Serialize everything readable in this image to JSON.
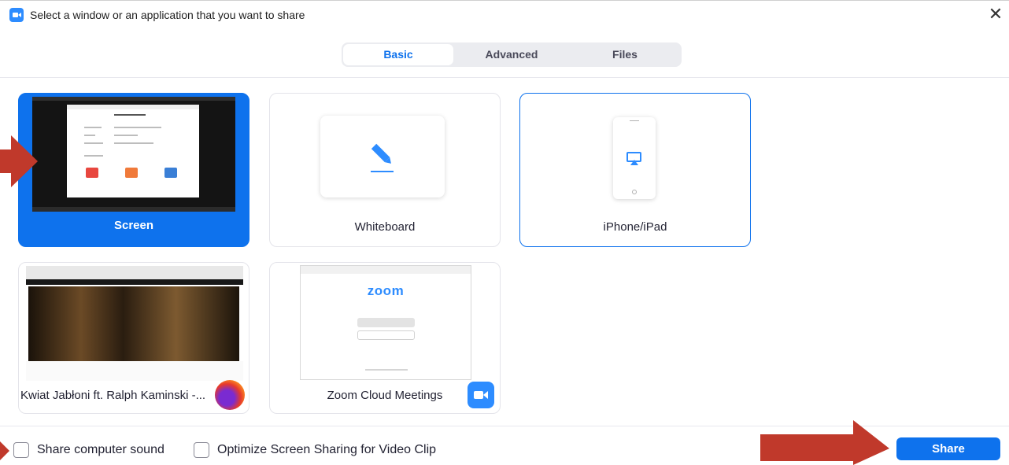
{
  "window": {
    "title": "Select a window or an application that you want to share",
    "close_glyph": "✕"
  },
  "tabs": [
    {
      "label": "Basic",
      "active": true
    },
    {
      "label": "Advanced",
      "active": false
    },
    {
      "label": "Files",
      "active": false
    }
  ],
  "tiles": {
    "screen": {
      "label": "Screen",
      "selected": true
    },
    "whiteboard": {
      "label": "Whiteboard",
      "icon": "pencil-icon"
    },
    "iphone": {
      "label": "iPhone/iPad",
      "icon": "airplay-icon"
    },
    "browser": {
      "label": "Kwiat Jabłoni ft. Ralph Kaminski -...",
      "icon": "firefox-icon"
    },
    "zoom": {
      "label": "Zoom Cloud Meetings",
      "icon": "zoom-app-icon",
      "thumbnail_logo": "zoom"
    }
  },
  "footer": {
    "share_sound_label": "Share computer sound",
    "optimize_label": "Optimize Screen Sharing for Video Clip",
    "share_button_label": "Share"
  },
  "colors": {
    "accent": "#0e72ed",
    "arrow": "#c0392b"
  }
}
